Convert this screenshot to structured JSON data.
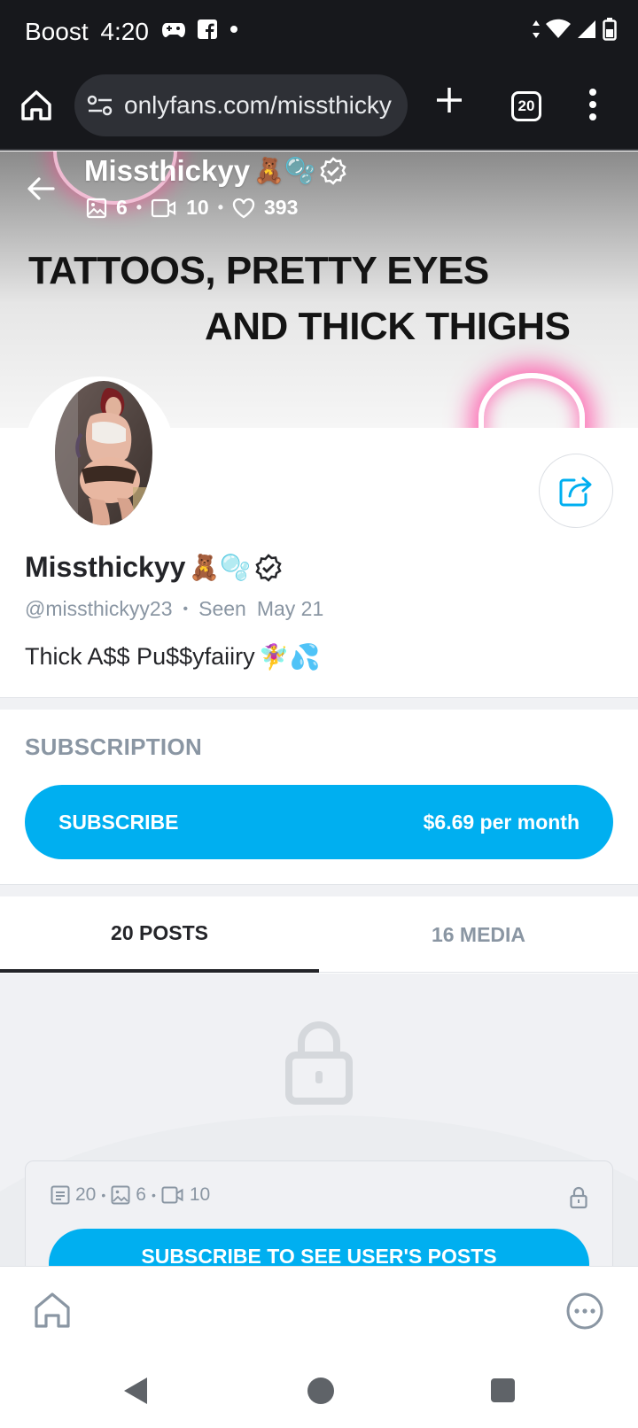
{
  "status_bar": {
    "carrier": "Boost",
    "time": "4:20"
  },
  "browser": {
    "url": "onlyfans.com/missthicky",
    "tab_count": "20"
  },
  "cover": {
    "tagline_line1": "TATTOOS, PRETTY EYES",
    "tagline_line2": "AND THICK THIGHS"
  },
  "header": {
    "name": "Missthickyy",
    "emojis": "🧸🫧",
    "photos_count": "6",
    "videos_count": "10",
    "likes_count": "393"
  },
  "profile": {
    "name": "Missthickyy",
    "emojis": "🧸🫧",
    "handle": "@missthickyy23",
    "seen_label": "Seen",
    "seen_date": "May 21",
    "bio": "Thick A$$ Pu$$yfaiiry",
    "bio_emojis": "🧚‍♀️💦"
  },
  "subscription": {
    "title": "SUBSCRIPTION",
    "button_label": "SUBSCRIBE",
    "price": "$6.69 per month"
  },
  "tabs": [
    {
      "label": "20 POSTS",
      "active": true
    },
    {
      "label": "16 MEDIA",
      "active": false
    }
  ],
  "locked_card": {
    "posts_count": "20",
    "photos_count": "6",
    "videos_count": "10",
    "button_label": "SUBSCRIBE TO SEE USER'S POSTS"
  },
  "colors": {
    "accent": "#00aff0",
    "muted_text": "#8a96a3",
    "dark_bar": "#17181c"
  }
}
